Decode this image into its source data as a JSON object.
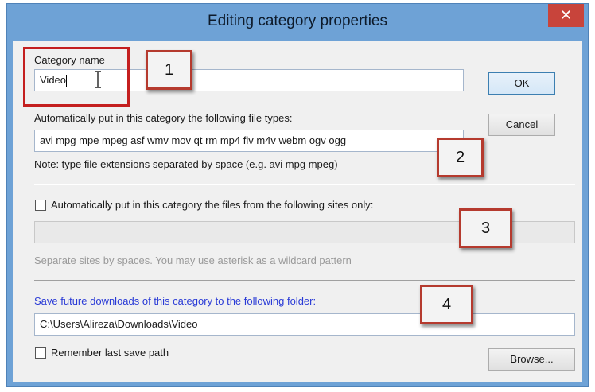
{
  "dialog": {
    "title": "Editing category properties",
    "close_glyph": "✕"
  },
  "category": {
    "label": "Category name",
    "value": "Video"
  },
  "buttons": {
    "ok": "OK",
    "cancel": "Cancel",
    "browse": "Browse..."
  },
  "file_types": {
    "label": "Automatically put in this category the following file types:",
    "value": "avi mpg mpe mpeg asf wmv mov qt rm mp4 flv m4v webm ogv ogg",
    "note": "Note: type file extensions separated by space (e.g. avi mpg mpeg)"
  },
  "sites": {
    "checkbox_label": "Automatically put in this category the files from the following sites only:",
    "checked": false,
    "value": "",
    "note": "Separate sites by spaces. You may use asterisk as a wildcard pattern"
  },
  "folder": {
    "label": "Save future downloads of this category to the following folder:",
    "value": "C:\\Users\\Alireza\\Downloads\\Video",
    "remember_label": "Remember last save path",
    "remember_checked": false
  },
  "callouts": [
    "1",
    "2",
    "3",
    "4"
  ],
  "colors": {
    "titlebar": "#6ea2d6",
    "close": "#c8443b",
    "callout_border": "#b53a2e",
    "highlight_frame": "#c41f1f",
    "folder_label": "#2a3bd6"
  },
  "icons": {
    "close": "close-icon",
    "cursor": "text-cursor-icon"
  }
}
